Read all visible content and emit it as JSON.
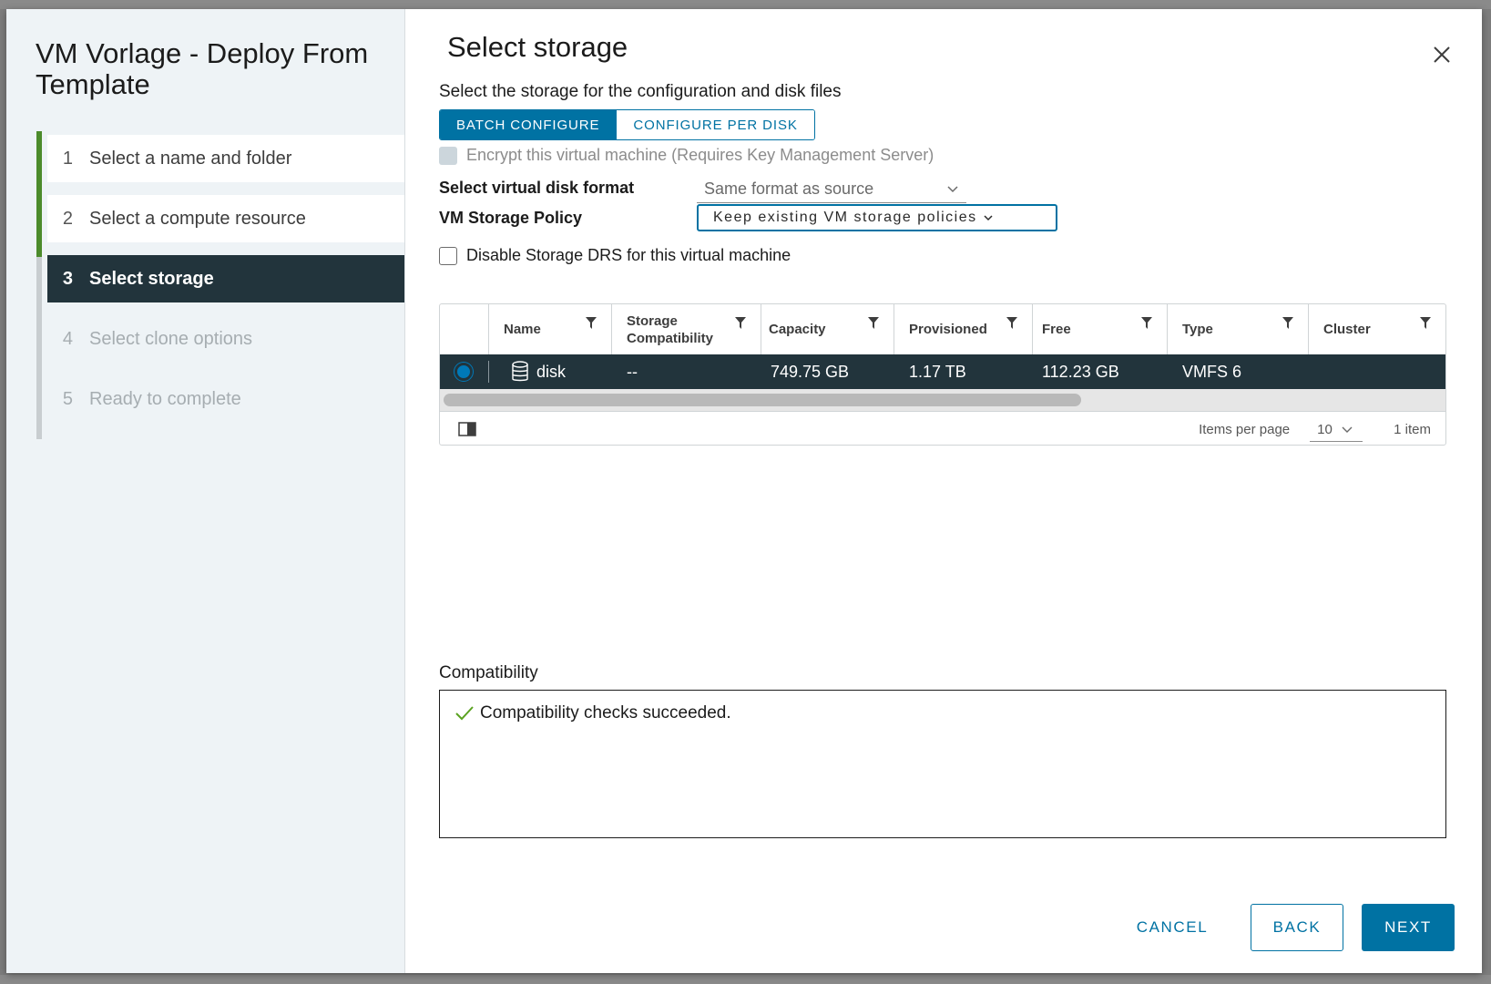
{
  "wizard": {
    "title": "VM Vorlage - Deploy From Template",
    "steps": [
      {
        "num": "1",
        "label": "Select a name and folder"
      },
      {
        "num": "2",
        "label": "Select a compute resource"
      },
      {
        "num": "3",
        "label": "Select storage"
      },
      {
        "num": "4",
        "label": "Select clone options"
      },
      {
        "num": "5",
        "label": "Ready to complete"
      }
    ]
  },
  "main": {
    "title": "Select storage",
    "subtitle": "Select the storage for the configuration and disk files",
    "batch_configure": "BATCH CONFIGURE",
    "configure_per_disk": "CONFIGURE PER DISK",
    "encrypt_label": "Encrypt this virtual machine (Requires Key Management Server)",
    "disk_format_label": "Select virtual disk format",
    "disk_format_value": "Same format as source",
    "policy_label": "VM Storage Policy",
    "policy_value": "Keep existing VM storage policies",
    "drs_label": "Disable Storage DRS for this virtual machine"
  },
  "grid": {
    "columns": [
      "Name",
      "Storage Compatibility",
      "Capacity",
      "Provisioned",
      "Free",
      "Type",
      "Cluster"
    ],
    "rows": [
      {
        "name": "disk",
        "compatibility": "--",
        "capacity": "749.75 GB",
        "provisioned": "1.17 TB",
        "free": "112.23 GB",
        "type": "VMFS 6",
        "cluster": ""
      }
    ],
    "items_per_page_label": "Items per page",
    "items_per_page_value": "10",
    "item_count": "1 item"
  },
  "compatibility": {
    "label": "Compatibility",
    "message": "Compatibility checks succeeded."
  },
  "footer": {
    "cancel": "CANCEL",
    "back": "BACK",
    "next": "NEXT"
  },
  "colors": {
    "accent": "#0072a3",
    "active_step": "#22343c",
    "done_bar": "#4c8b2b",
    "success_check": "#5aa220"
  }
}
